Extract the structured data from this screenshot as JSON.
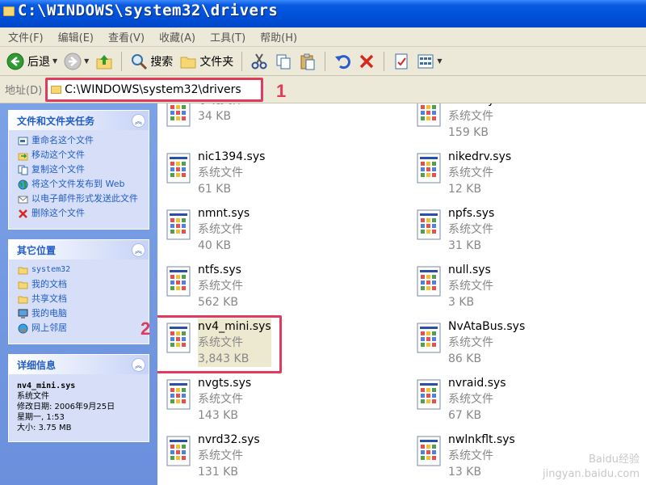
{
  "window": {
    "title": "C:\\WINDOWS\\system32\\drivers"
  },
  "menu": [
    "文件(F)",
    "编辑(E)",
    "查看(V)",
    "收藏(A)",
    "工具(T)",
    "帮助(H)"
  ],
  "toolbar": {
    "back_label": "后退",
    "search_label": "搜索",
    "folders_label": "文件夹"
  },
  "address": {
    "label": "地址(D)",
    "path": "C:\\WINDOWS\\system32\\drivers"
  },
  "callouts": {
    "one": "1",
    "two": "2"
  },
  "tasks": {
    "title": "文件和文件夹任务",
    "items": [
      {
        "label": "重命名这个文件",
        "icon": "rename-icon"
      },
      {
        "label": "移动这个文件",
        "icon": "move-icon"
      },
      {
        "label": "复制这个文件",
        "icon": "copy-icon"
      },
      {
        "label": "将这个文件发布到 Web",
        "icon": "globe-icon"
      },
      {
        "label": "以电子邮件形式发送此文件",
        "icon": "email-icon"
      },
      {
        "label": "删除这个文件",
        "icon": "delete-icon"
      }
    ]
  },
  "places": {
    "title": "其它位置",
    "items": [
      {
        "label": "system32",
        "icon": "folder-icon"
      },
      {
        "label": "我的文档",
        "icon": "folder-icon"
      },
      {
        "label": "共享文档",
        "icon": "folder-icon"
      },
      {
        "label": "我的电脑",
        "icon": "computer-icon"
      },
      {
        "label": "网上邻居",
        "icon": "network-icon"
      }
    ]
  },
  "details": {
    "title": "详细信息",
    "name": "nv4_mini.sys",
    "type": "系统文件",
    "modified": "修改日期: 2006年9月25日",
    "weekday": "星期一, 1:53",
    "size": "大小: 3.75 MB"
  },
  "files": [
    {
      "name": "",
      "type": "系统文件",
      "size": "34 KB"
    },
    {
      "name": "netbt.sys",
      "type": "系统文件",
      "size": "159 KB"
    },
    {
      "name": "nic1394.sys",
      "type": "系统文件",
      "size": "61 KB"
    },
    {
      "name": "nikedrv.sys",
      "type": "系统文件",
      "size": "12 KB"
    },
    {
      "name": "nmnt.sys",
      "type": "系统文件",
      "size": "40 KB"
    },
    {
      "name": "npfs.sys",
      "type": "系统文件",
      "size": "31 KB"
    },
    {
      "name": "ntfs.sys",
      "type": "系统文件",
      "size": "562 KB"
    },
    {
      "name": "null.sys",
      "type": "系统文件",
      "size": "3 KB"
    },
    {
      "name": "nv4_mini.sys",
      "type": "系统文件",
      "size": "3,843 KB"
    },
    {
      "name": "NvAtaBus.sys",
      "type": "系统文件",
      "size": "86 KB"
    },
    {
      "name": "nvgts.sys",
      "type": "系统文件",
      "size": "143 KB"
    },
    {
      "name": "nvraid.sys",
      "type": "系统文件",
      "size": "67 KB"
    },
    {
      "name": "nvrd32.sys",
      "type": "系统文件",
      "size": "131 KB"
    },
    {
      "name": "nwlnkflt.sys",
      "type": "系统文件",
      "size": "13 KB"
    }
  ],
  "watermark": {
    "line1": "Baidu经验",
    "line2": "jingyan.baidu.com"
  },
  "colors": {
    "accent": "#e03a5c",
    "titlebar": "#0050d8",
    "taskpane": "#6b8fdc",
    "link": "#215dc6"
  }
}
